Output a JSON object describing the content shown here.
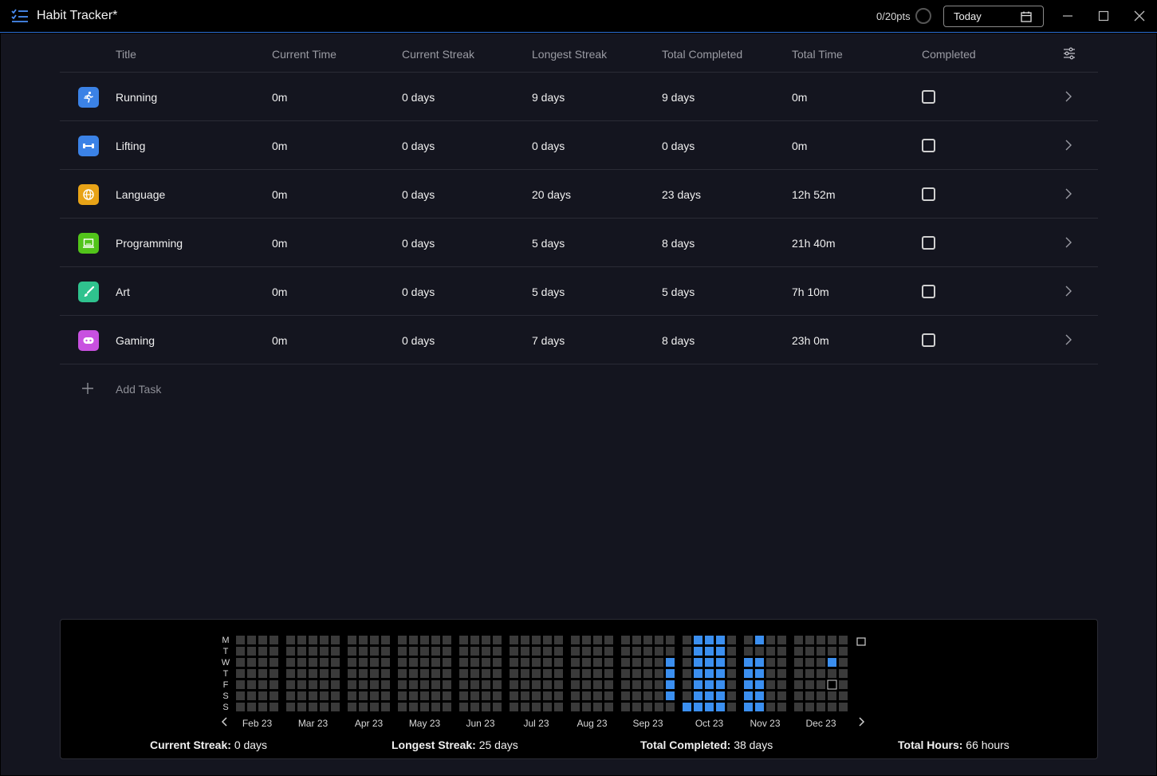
{
  "window": {
    "title": "Habit Tracker*",
    "points": "0/20pts",
    "date_button": "Today"
  },
  "table": {
    "headers": {
      "title": "Title",
      "current_time": "Current Time",
      "current_streak": "Current Streak",
      "longest_streak": "Longest Streak",
      "total_completed": "Total Completed",
      "total_time": "Total Time",
      "completed": "Completed"
    },
    "rows": [
      {
        "title": "Running",
        "icon": "running-icon",
        "color": "#3b82e6",
        "current_time": "0m",
        "current_streak": "0 days",
        "longest_streak": "9 days",
        "total_completed": "9 days",
        "total_time": "0m",
        "completed": false
      },
      {
        "title": "Lifting",
        "icon": "dumbbell-icon",
        "color": "#3b82e6",
        "current_time": "0m",
        "current_streak": "0 days",
        "longest_streak": "0 days",
        "total_completed": "0 days",
        "total_time": "0m",
        "completed": false
      },
      {
        "title": "Language",
        "icon": "globe-icon",
        "color": "#e8a317",
        "current_time": "0m",
        "current_streak": "0 days",
        "longest_streak": "20 days",
        "total_completed": "23 days",
        "total_time": "12h 52m",
        "completed": false
      },
      {
        "title": "Programming",
        "icon": "laptop-icon",
        "color": "#52c41a",
        "current_time": "0m",
        "current_streak": "0 days",
        "longest_streak": "5 days",
        "total_completed": "8 days",
        "total_time": "21h 40m",
        "completed": false
      },
      {
        "title": "Art",
        "icon": "brush-icon",
        "color": "#2fc28e",
        "current_time": "0m",
        "current_streak": "0 days",
        "longest_streak": "5 days",
        "total_completed": "5 days",
        "total_time": "7h 10m",
        "completed": false
      },
      {
        "title": "Gaming",
        "icon": "gamepad-icon",
        "color": "#c850e0",
        "current_time": "0m",
        "current_streak": "0 days",
        "longest_streak": "7 days",
        "total_completed": "8 days",
        "total_time": "23h 0m",
        "completed": false
      }
    ],
    "add_task_label": "Add Task"
  },
  "heatmap": {
    "day_labels": [
      "M",
      "T",
      "W",
      "T",
      "F",
      "S",
      "S"
    ],
    "months": [
      "Feb 23",
      "Mar 23",
      "Apr 23",
      "May 23",
      "Jun 23",
      "Jul 23",
      "Aug 23",
      "Sep 23",
      "Oct 23",
      "Nov 23",
      "Dec 23"
    ],
    "colors": {
      "empty": "#3a3a3a",
      "filled": "#3b8ff0"
    }
  },
  "stats": {
    "current_streak_label": "Current Streak:",
    "current_streak": "0 days",
    "longest_streak_label": "Longest Streak:",
    "longest_streak": "25 days",
    "total_completed_label": "Total Completed:",
    "total_completed": "38 days",
    "total_hours_label": "Total Hours:",
    "total_hours": "66 hours"
  }
}
